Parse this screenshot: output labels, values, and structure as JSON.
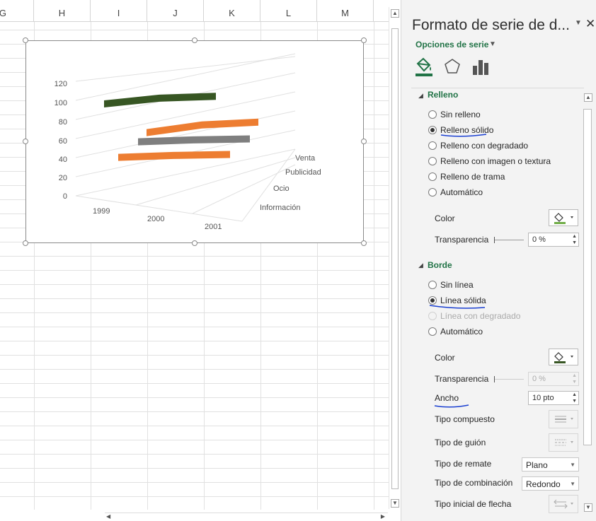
{
  "columns": [
    "G",
    "H",
    "I",
    "J",
    "K",
    "L",
    "M"
  ],
  "chart": {
    "type": "3d-line",
    "x_categories": [
      "1999",
      "2000",
      "2001"
    ],
    "depth_categories": [
      "Venta",
      "Publicidad",
      "Ocio",
      "Información"
    ],
    "y_ticks": [
      "0",
      "20",
      "40",
      "60",
      "80",
      "100",
      "120"
    ],
    "colors": {
      "green": "#375623",
      "orange": "#ed7d31",
      "gray": "#7f7f7f"
    }
  },
  "chart_data": {
    "type": "line",
    "categories": [
      "1999",
      "2000",
      "2001"
    ],
    "ylim": [
      0,
      120
    ],
    "series": [
      {
        "values": [
          100,
          106,
          108
        ]
      },
      {
        "values": [
          44,
          52,
          55
        ]
      },
      {
        "values": [
          44,
          46,
          47
        ]
      },
      {
        "values": [
          44,
          46,
          47
        ]
      }
    ]
  },
  "pane": {
    "title": "Formato de serie de d...",
    "series_options": "Opciones de serie",
    "tab_icons": [
      "fill-line-icon",
      "effects-pentagon-icon",
      "series-options-bars-icon"
    ],
    "fill": {
      "title": "Relleno",
      "options": [
        {
          "label": "Sin relleno",
          "checked": false
        },
        {
          "label": "Relleno sólido",
          "checked": true
        },
        {
          "label": "Relleno con degradado",
          "checked": false
        },
        {
          "label": "Relleno con imagen o textura",
          "checked": false
        },
        {
          "label": "Relleno de trama",
          "checked": false
        },
        {
          "label": "Automático",
          "checked": false
        }
      ],
      "color_label": "Color",
      "transparency_label": "Transparencia",
      "transparency_value": "0 %"
    },
    "border": {
      "title": "Borde",
      "options": [
        {
          "label": "Sin línea",
          "checked": false
        },
        {
          "label": "Línea sólida",
          "checked": true
        },
        {
          "label": "Línea con degradado",
          "checked": false,
          "disabled": true
        },
        {
          "label": "Automático",
          "checked": false
        }
      ],
      "color_label": "Color",
      "transparency_label": "Transparencia",
      "transparency_value": "0 %",
      "width_label": "Ancho",
      "width_value": "10 pto",
      "compound_label": "Tipo compuesto",
      "dash_label": "Tipo de guión",
      "cap_label": "Tipo de remate",
      "cap_value": "Plano",
      "join_label": "Tipo de combinación",
      "join_value": "Redondo",
      "arrow_label": "Tipo inicial de flecha"
    }
  }
}
